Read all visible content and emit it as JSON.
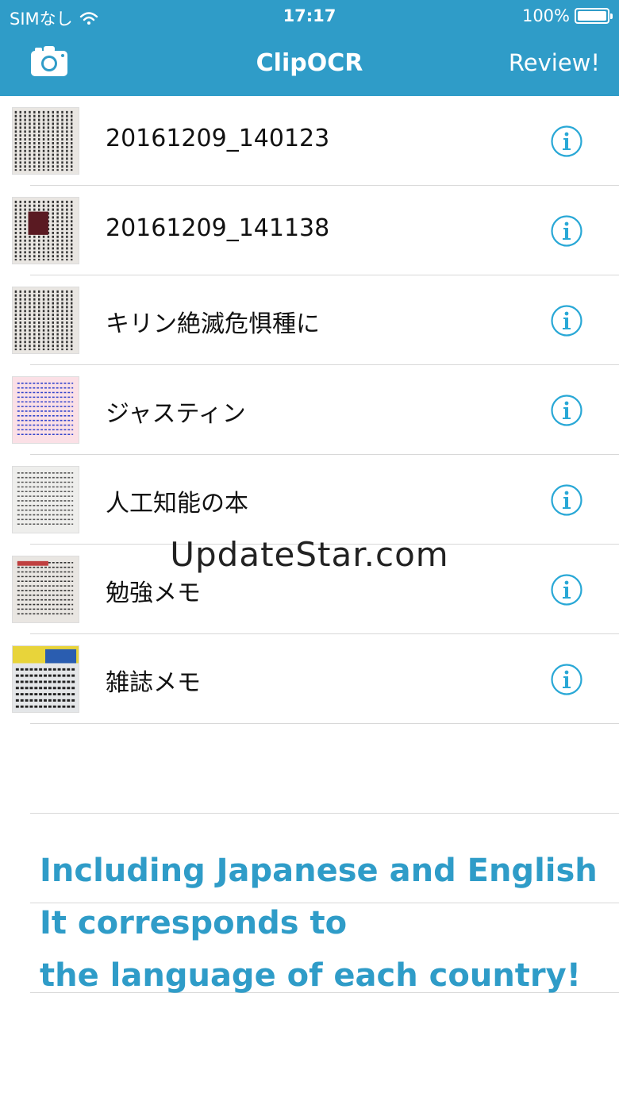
{
  "status_bar": {
    "carrier": "SIMなし",
    "time": "17:17",
    "battery": "100%"
  },
  "nav": {
    "title": "ClipOCR",
    "review_label": "Review!",
    "camera_icon": "camera-icon"
  },
  "items": [
    {
      "label": "20161209_140123",
      "thumb_style": "newspaper"
    },
    {
      "label": "20161209_141138",
      "thumb_style": "newspaper-photo"
    },
    {
      "label": "キリン絶滅危惧種に",
      "thumb_style": "newspaper"
    },
    {
      "label": "ジャスティン",
      "thumb_style": "pink-text"
    },
    {
      "label": "人工知能の本",
      "thumb_style": "book"
    },
    {
      "label": "勉強メモ",
      "thumb_style": "chapter"
    },
    {
      "label": "雑誌メモ",
      "thumb_style": "magazine"
    }
  ],
  "watermark": "UpdateStar.com",
  "promo": {
    "line1": "Including Japanese and English",
    "line2": "It corresponds to",
    "line3": "the language of each country!"
  },
  "colors": {
    "brand_blue": "#2f9cc8",
    "info_icon": "#29a8d6"
  }
}
